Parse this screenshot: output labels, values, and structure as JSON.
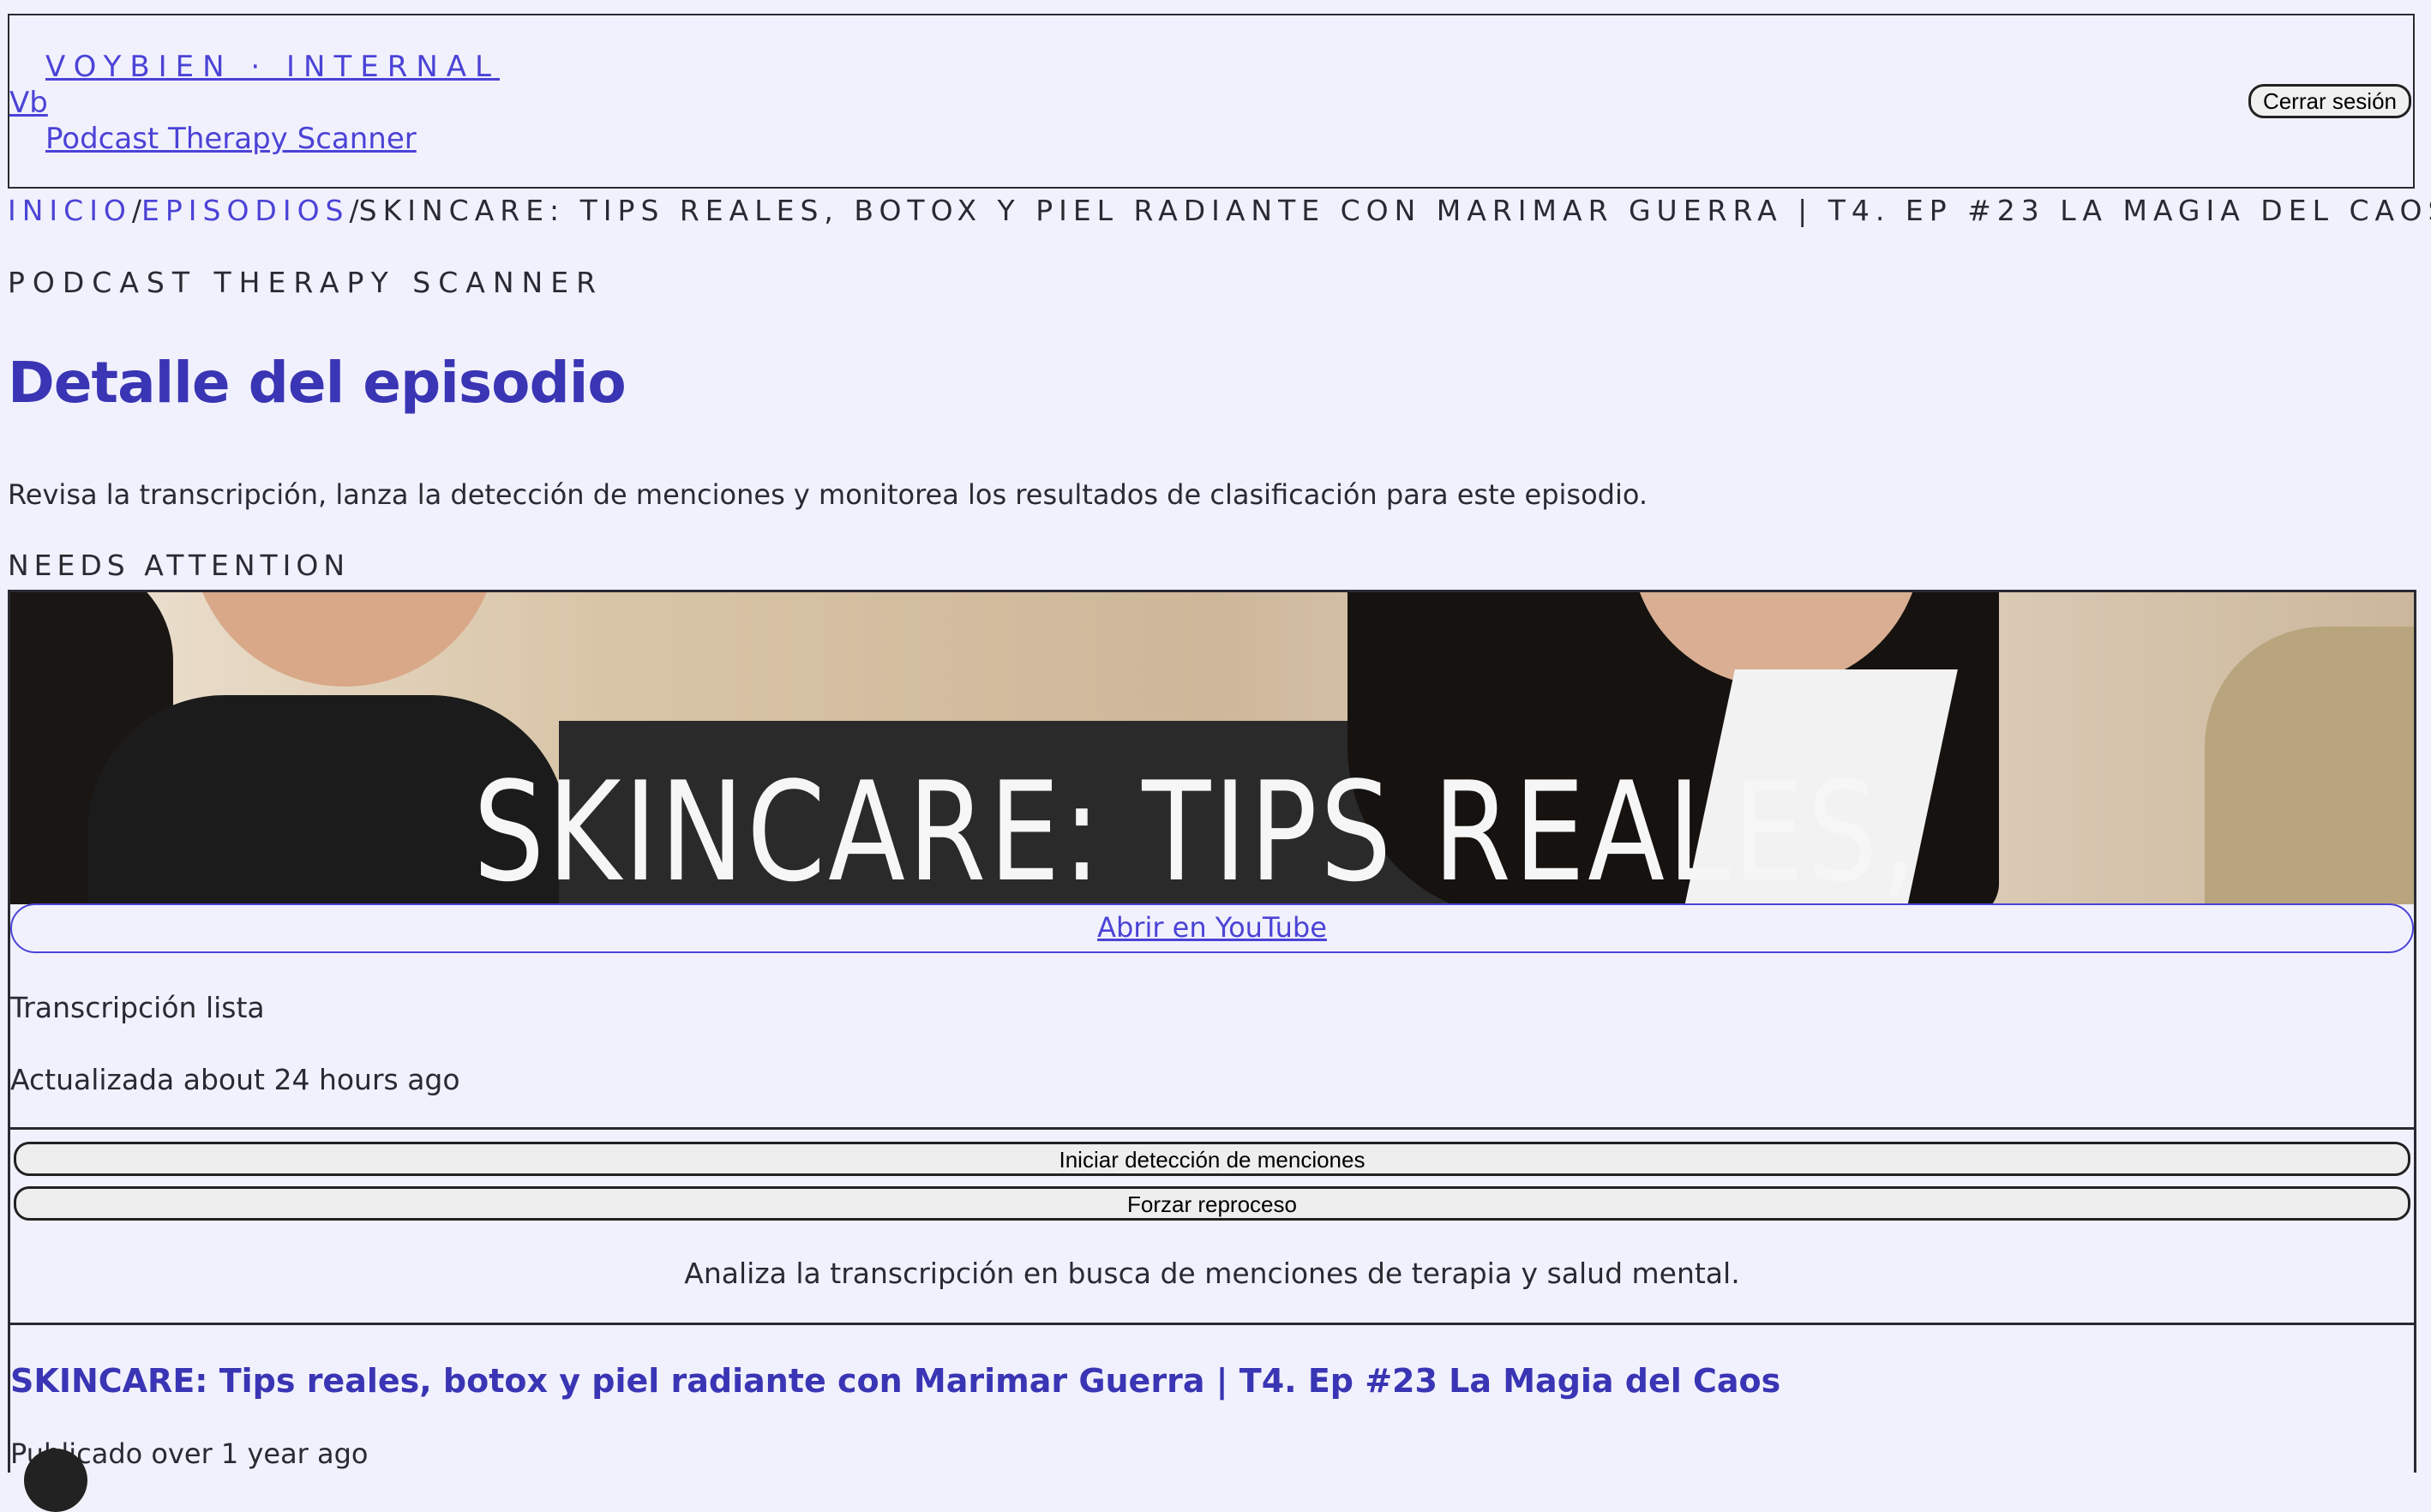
{
  "header": {
    "eyebrow": "VOYBIEN · INTERNAL",
    "logo_text": "Vb",
    "product_name": "Podcast Therapy Scanner",
    "logout_label": "Cerrar sesión"
  },
  "breadcrumb": {
    "items": [
      "INICIO",
      "EPISODIOS"
    ],
    "separator": "/",
    "current": "SKINCARE: TIPS REALES, BOTOX Y PIEL RADIANTE CON MARIMAR GUERRA | T4. EP #23 LA MAGIA DEL CAOS"
  },
  "page": {
    "eyebrow": "PODCAST THERAPY SCANNER",
    "title": "Detalle del episodio",
    "description": "Revisa la transcripción, lanza la detección de menciones y monitorea los resultados de clasificación para este episodio.",
    "status_label": "NEEDS ATTENTION"
  },
  "episode_card": {
    "thumbnail_text": "SKINCARE: TIPS REALES,",
    "youtube_link_label": "Abrir en YouTube",
    "transcript_status": "Transcripción lista",
    "transcript_updated": "Actualizada about 24 hours ago",
    "detect_button_label": "Iniciar detección de menciones",
    "reprocess_button_label": "Forzar reproceso",
    "action_help": "Analiza la transcripción en busca de menciones de terapia y salud mental.",
    "episode_title": "SKINCARE: Tips reales, botox y piel radiante con Marimar Guerra | T4. Ep #23 La Magia del Caos",
    "published": "Publicado over 1 year ago"
  },
  "colors": {
    "background": "#f1f1fd",
    "accent": "#4b43d6",
    "title": "#3a35b4",
    "text": "#2a2a33"
  }
}
